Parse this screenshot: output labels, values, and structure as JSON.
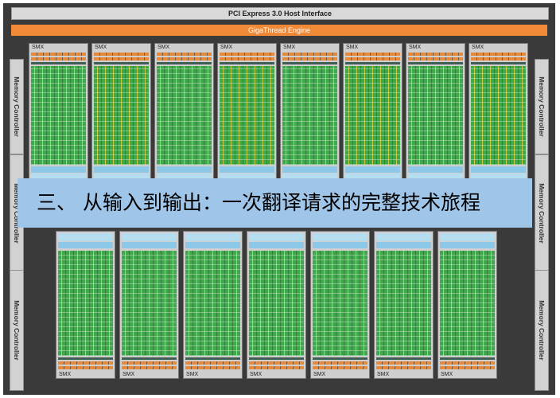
{
  "diagram": {
    "pcie_label": "PCI Express 3.0 Host Interface",
    "gigathread_label": "GigaThread Engine",
    "memory_controller_label": "Memory Controller",
    "smx_label": "SMX"
  },
  "caption": {
    "text": "三、 从输入到输出：一次翻译请求的完整技术旅程"
  }
}
